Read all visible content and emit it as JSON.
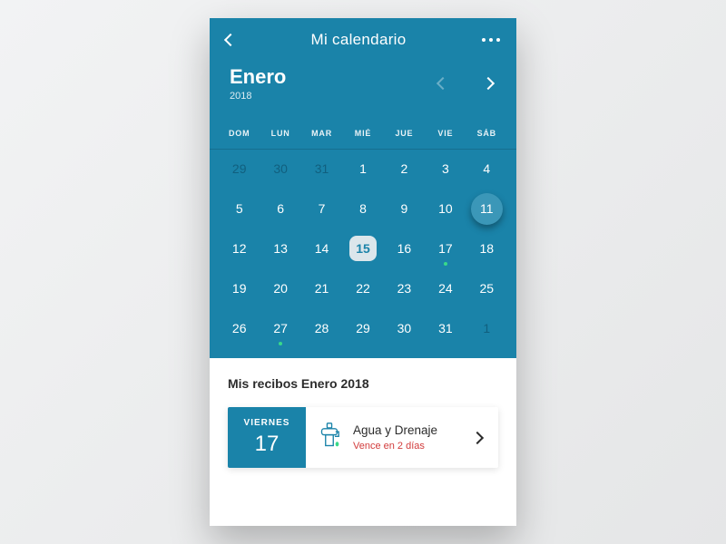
{
  "header": {
    "title": "Mi calendario"
  },
  "month": {
    "label": "Enero",
    "year": "2018"
  },
  "weekdays": [
    "DOM",
    "LUN",
    "MAR",
    "MIÉ",
    "JUE",
    "VIE",
    "SÁB"
  ],
  "grid": [
    {
      "n": "29",
      "out": true
    },
    {
      "n": "30",
      "out": true
    },
    {
      "n": "31",
      "out": true
    },
    {
      "n": "1"
    },
    {
      "n": "2"
    },
    {
      "n": "3"
    },
    {
      "n": "4"
    },
    {
      "n": "5"
    },
    {
      "n": "6"
    },
    {
      "n": "7"
    },
    {
      "n": "8"
    },
    {
      "n": "9"
    },
    {
      "n": "10"
    },
    {
      "n": "11",
      "today": true
    },
    {
      "n": "12"
    },
    {
      "n": "13"
    },
    {
      "n": "14"
    },
    {
      "n": "15",
      "selected": true
    },
    {
      "n": "16"
    },
    {
      "n": "17",
      "dot": true
    },
    {
      "n": "18"
    },
    {
      "n": "19"
    },
    {
      "n": "20"
    },
    {
      "n": "21"
    },
    {
      "n": "22"
    },
    {
      "n": "23"
    },
    {
      "n": "24"
    },
    {
      "n": "25"
    },
    {
      "n": "26"
    },
    {
      "n": "27",
      "dot": true
    },
    {
      "n": "28"
    },
    {
      "n": "29"
    },
    {
      "n": "30"
    },
    {
      "n": "31"
    },
    {
      "n": "1",
      "out": true
    }
  ],
  "list": {
    "title": "Mis recibos Enero 2018",
    "item": {
      "dow": "VIERNES",
      "day": "17",
      "title": "Agua y Drenaje",
      "subtitle": "Vence en 2 días"
    }
  }
}
